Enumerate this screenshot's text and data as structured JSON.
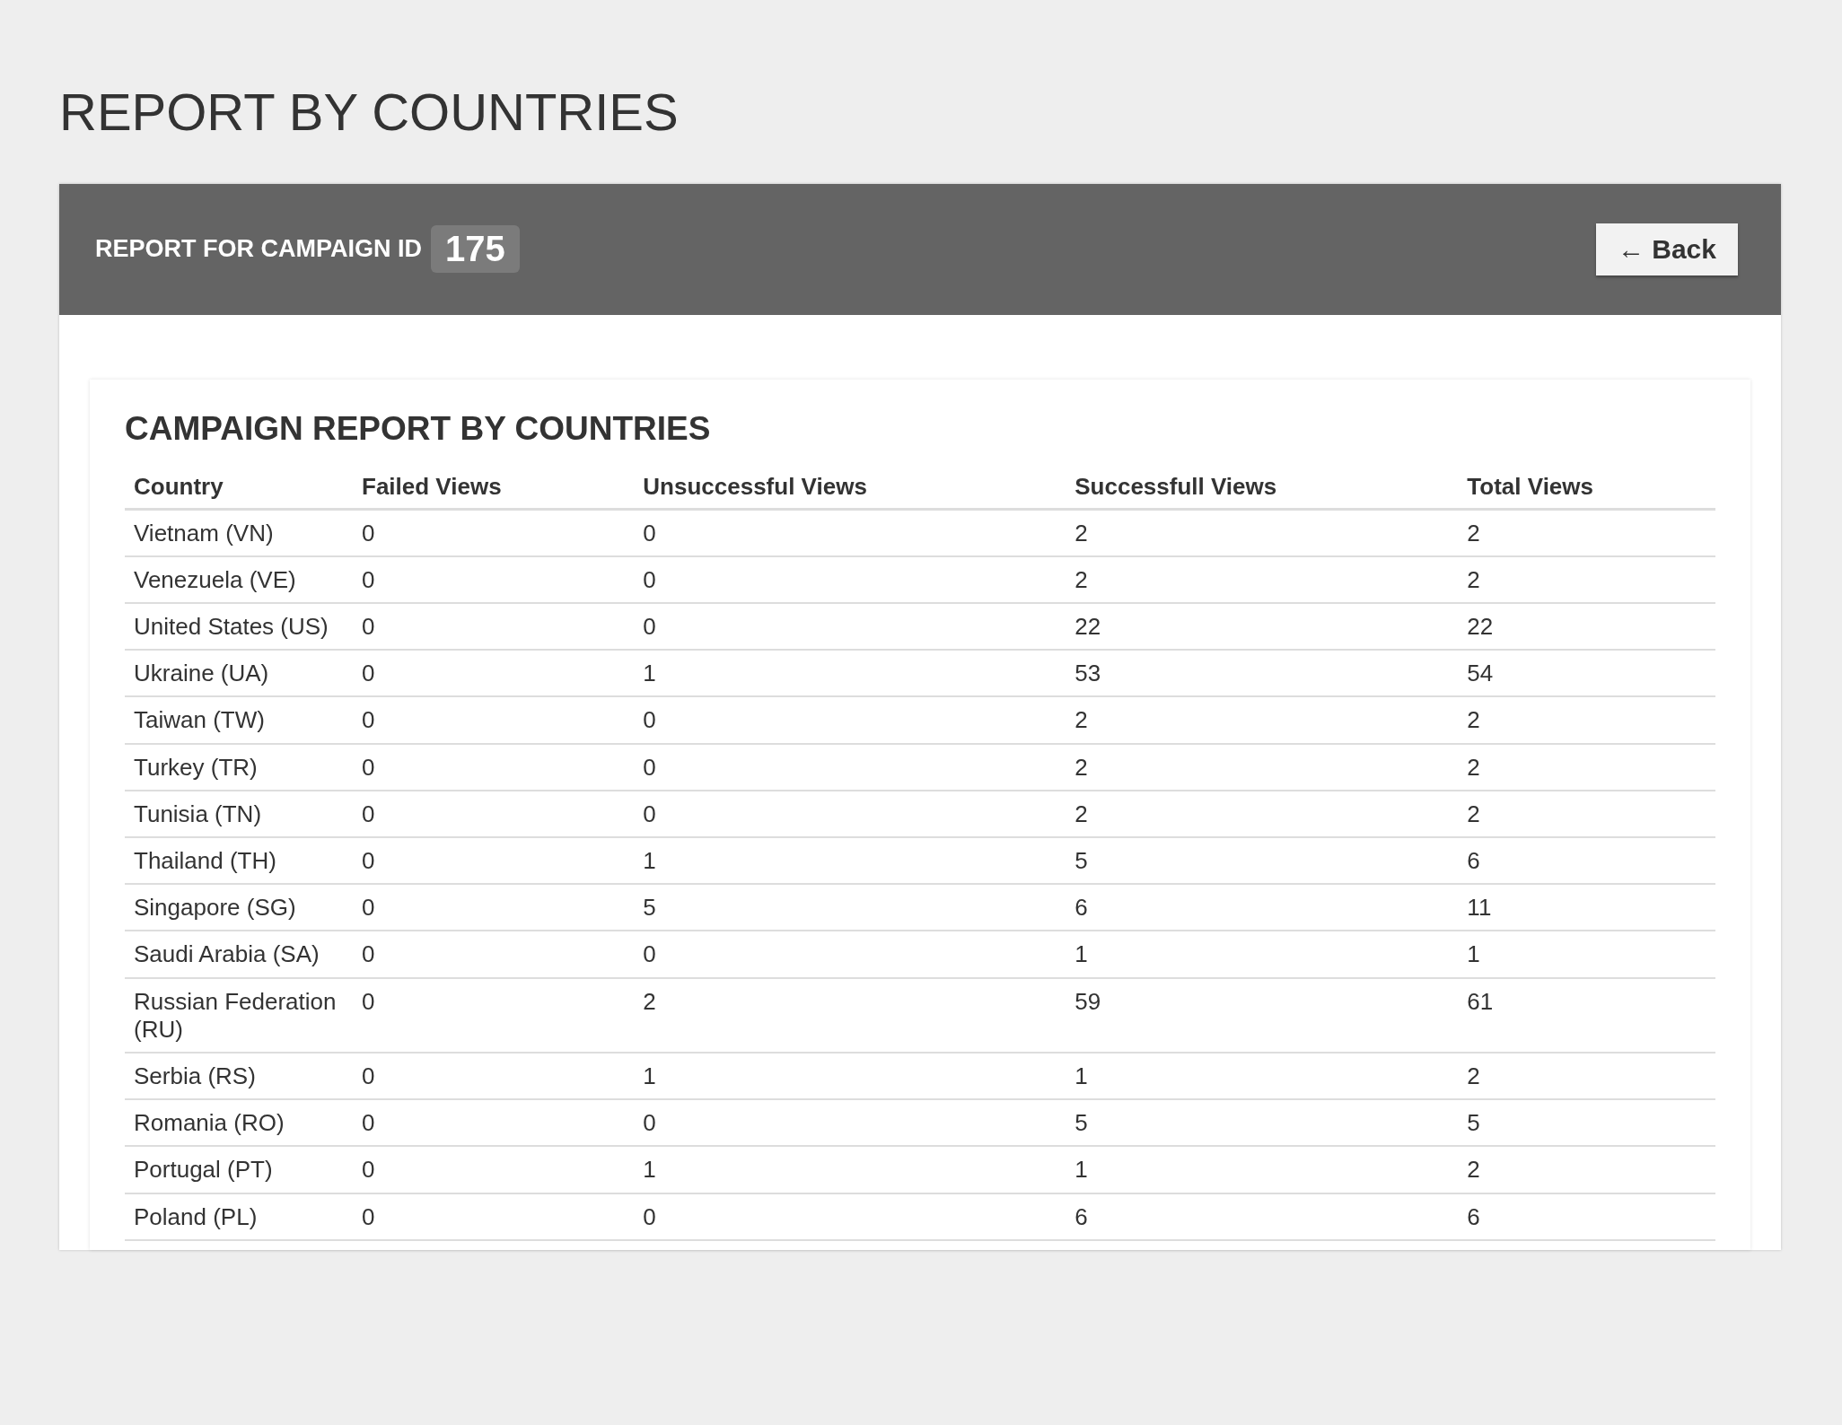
{
  "page_title": "REPORT BY COUNTRIES",
  "panel": {
    "heading": "REPORT FOR CAMPAIGN ID",
    "campaign_id": "175",
    "back_button": {
      "icon": "←",
      "label": "Back"
    }
  },
  "report": {
    "title": "CAMPAIGN REPORT BY COUNTRIES",
    "columns": [
      "Country",
      "Failed Views",
      "Unsuccessful Views",
      "Successfull Views",
      "Total Views"
    ],
    "rows": [
      [
        "Vietnam (VN)",
        "0",
        "0",
        "2",
        "2"
      ],
      [
        "Venezuela (VE)",
        "0",
        "0",
        "2",
        "2"
      ],
      [
        "United States (US)",
        "0",
        "0",
        "22",
        "22"
      ],
      [
        "Ukraine (UA)",
        "0",
        "1",
        "53",
        "54"
      ],
      [
        "Taiwan (TW)",
        "0",
        "0",
        "2",
        "2"
      ],
      [
        "Turkey (TR)",
        "0",
        "0",
        "2",
        "2"
      ],
      [
        "Tunisia (TN)",
        "0",
        "0",
        "2",
        "2"
      ],
      [
        "Thailand (TH)",
        "0",
        "1",
        "5",
        "6"
      ],
      [
        "Singapore (SG)",
        "0",
        "5",
        "6",
        "11"
      ],
      [
        "Saudi Arabia (SA)",
        "0",
        "0",
        "1",
        "1"
      ],
      [
        "Russian Federation (RU)",
        "0",
        "2",
        "59",
        "61"
      ],
      [
        "Serbia (RS)",
        "0",
        "1",
        "1",
        "2"
      ],
      [
        "Romania (RO)",
        "0",
        "0",
        "5",
        "5"
      ],
      [
        "Portugal (PT)",
        "0",
        "1",
        "1",
        "2"
      ],
      [
        "Poland (PL)",
        "0",
        "0",
        "6",
        "6"
      ]
    ]
  }
}
